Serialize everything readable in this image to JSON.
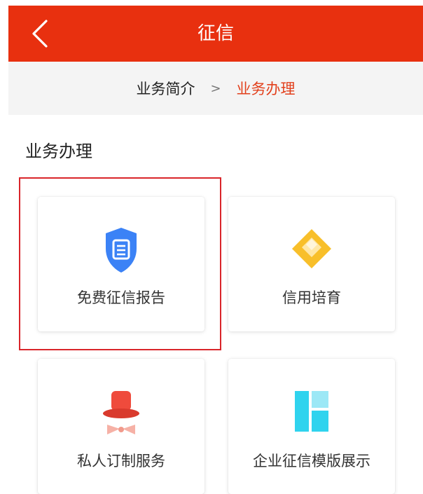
{
  "header": {
    "title": "征信"
  },
  "breadcrumb": {
    "parent": "业务简介",
    "separator": ">",
    "current": "业务办理"
  },
  "section": {
    "title": "业务办理"
  },
  "cards": [
    {
      "label": "免费征信报告",
      "icon": "shield-document-icon"
    },
    {
      "label": "信用培育",
      "icon": "diamond-icon"
    },
    {
      "label": "私人订制服务",
      "icon": "top-hat-bowtie-icon"
    },
    {
      "label": "企业征信模版展示",
      "icon": "layout-template-icon"
    }
  ],
  "colors": {
    "header_bg": "#e8300f",
    "accent": "#e2401c",
    "highlight_border": "#d9252a",
    "shield_blue": "#3b82f6",
    "diamond_yellow": "#f8bf2a",
    "hat_red": "#ef4b3c",
    "template_cyan": "#2fd3ee"
  }
}
